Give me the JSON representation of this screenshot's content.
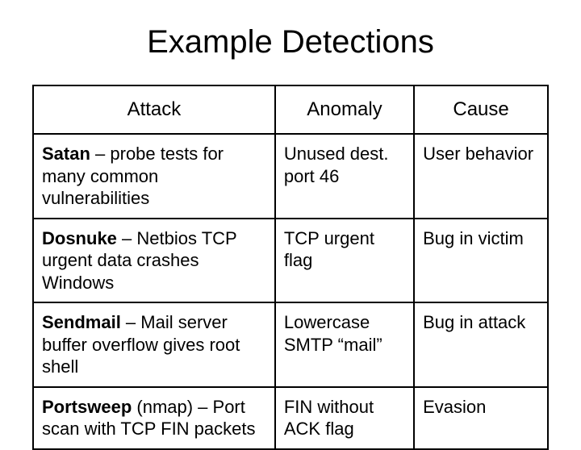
{
  "title": "Example Detections",
  "headers": {
    "attack": "Attack",
    "anomaly": "Anomaly",
    "cause": "Cause"
  },
  "rows": [
    {
      "name": "Satan",
      "desc": " – probe tests for many common vulnerabilities",
      "anomaly": "Unused dest. port 46",
      "cause": "User behavior"
    },
    {
      "name": "Dosnuke",
      "desc": " – Netbios TCP urgent data crashes Windows",
      "anomaly": "TCP urgent flag",
      "cause": "Bug in victim"
    },
    {
      "name": "Sendmail",
      "desc": " – Mail server buffer overflow gives root shell",
      "anomaly": "Lowercase SMTP “mail”",
      "cause": "Bug in attack"
    },
    {
      "name": "Portsweep",
      "desc": " (nmap) – Port scan with TCP FIN packets",
      "anomaly": "FIN without ACK flag",
      "cause": "Evasion"
    }
  ],
  "chart_data": {
    "type": "table",
    "columns": [
      "Attack",
      "Anomaly",
      "Cause"
    ],
    "rows": [
      [
        "Satan – probe tests for many common vulnerabilities",
        "Unused dest. port 46",
        "User behavior"
      ],
      [
        "Dosnuke – Netbios TCP urgent data crashes Windows",
        "TCP urgent flag",
        "Bug in victim"
      ],
      [
        "Sendmail – Mail server buffer overflow gives root shell",
        "Lowercase SMTP “mail”",
        "Bug in attack"
      ],
      [
        "Portsweep (nmap) – Port scan with TCP FIN packets",
        "FIN without ACK flag",
        "Evasion"
      ]
    ]
  }
}
